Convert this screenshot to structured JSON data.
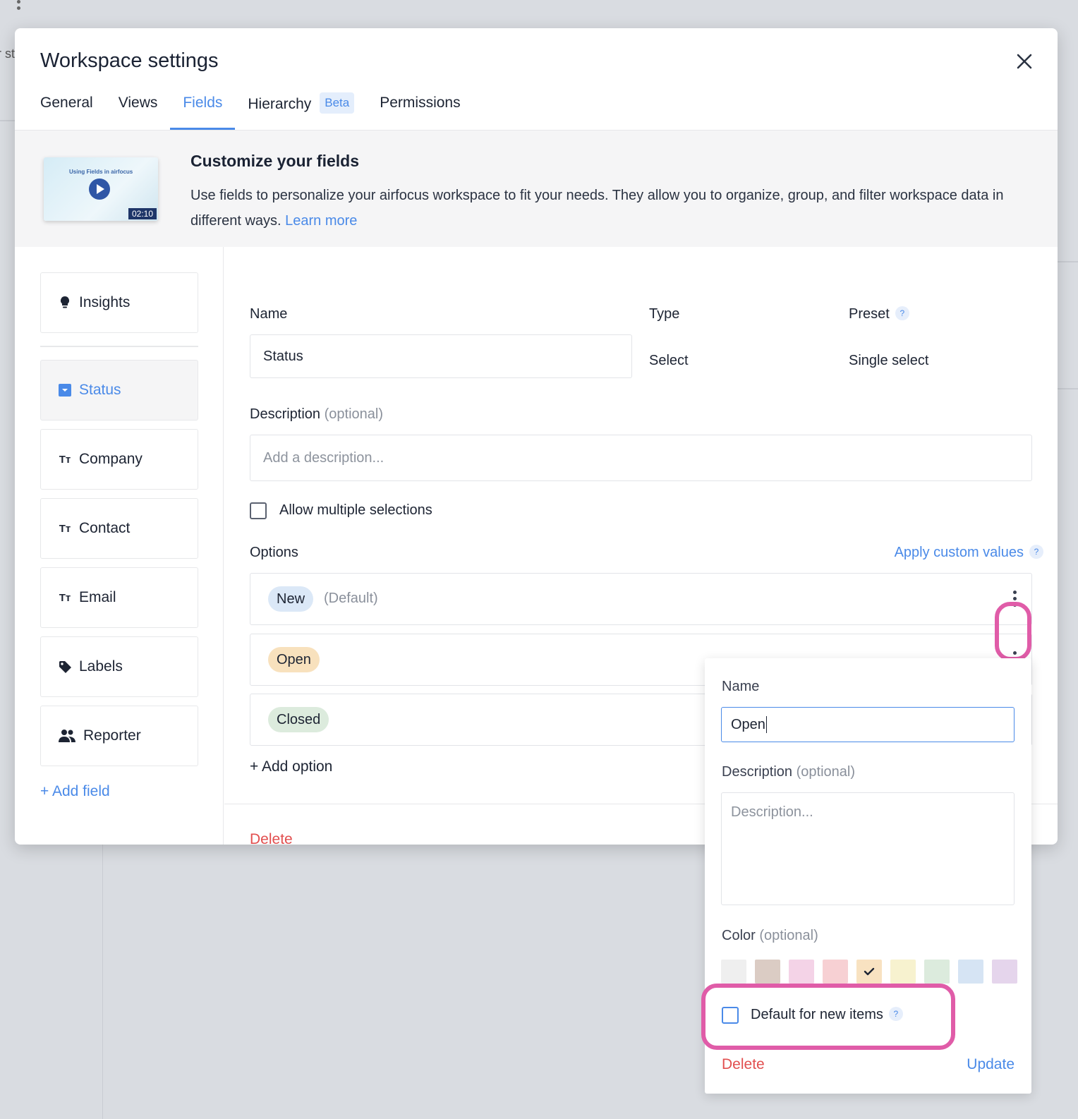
{
  "background": {
    "partial_text": "r st"
  },
  "modal": {
    "title": "Workspace settings",
    "tabs": [
      {
        "label": "General"
      },
      {
        "label": "Views"
      },
      {
        "label": "Fields",
        "active": true
      },
      {
        "label": "Hierarchy",
        "badge": "Beta"
      },
      {
        "label": "Permissions"
      }
    ]
  },
  "banner": {
    "video_caption": "Using Fields in airfocus",
    "video_duration": "02:10",
    "title": "Customize your fields",
    "text": "Use fields to personalize your airfocus workspace to fit your needs. They allow you to organize, group, and filter workspace data in different ways.",
    "link": "Learn more"
  },
  "sidebar": {
    "items": [
      {
        "label": "Insights",
        "icon": "lightbulb-icon"
      },
      {
        "label": "Status",
        "icon": "select-icon",
        "active": true
      },
      {
        "label": "Company",
        "icon": "text-icon"
      },
      {
        "label": "Contact",
        "icon": "text-icon"
      },
      {
        "label": "Email",
        "icon": "text-icon"
      },
      {
        "label": "Labels",
        "icon": "tag-icon"
      },
      {
        "label": "Reporter",
        "icon": "users-icon"
      }
    ],
    "add_field": "+ Add field"
  },
  "field_form": {
    "name_label": "Name",
    "name_value": "Status",
    "type_label": "Type",
    "type_value": "Select",
    "preset_label": "Preset",
    "preset_help": "?",
    "preset_value": "Single select",
    "description_label": "Description",
    "optional": "(optional)",
    "description_placeholder": "Add a description...",
    "allow_multiple": "Allow multiple selections",
    "options_label": "Options",
    "apply_custom": "Apply custom values",
    "apply_help": "?",
    "options": [
      {
        "label": "New",
        "note": "(Default)",
        "color": "#dbe8f7"
      },
      {
        "label": "Open",
        "color": "#f8e1bd"
      },
      {
        "label": "Closed",
        "color": "#dcebdd"
      }
    ],
    "add_option": "+ Add option",
    "delete": "Delete"
  },
  "option_editor": {
    "name_label": "Name",
    "name_value": "Open",
    "description_label": "Description",
    "optional": "(optional)",
    "description_placeholder": "Description...",
    "color_label": "Color",
    "colors": [
      "#efefef",
      "#dbccc4",
      "#f4d3e7",
      "#f7d0d3",
      "#f8e2c1",
      "#f7f2cf",
      "#dcebdd",
      "#d6e4f4",
      "#e5d5ec"
    ],
    "selected_color": "#f8e2c1",
    "default_label": "Default for new items",
    "default_help": "?",
    "delete": "Delete",
    "update": "Update"
  }
}
